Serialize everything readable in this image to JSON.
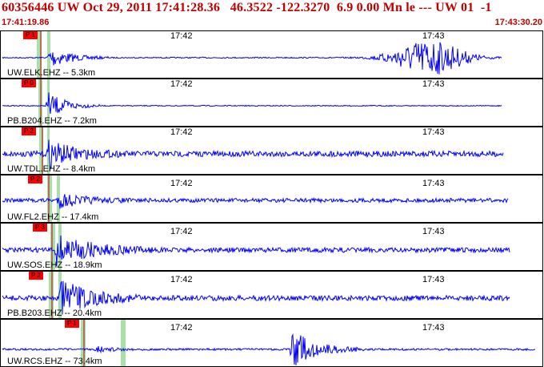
{
  "header": {
    "title": "60356446 UW Oct 29, 2011 17:41:28.36   46.3522 -122.3270  6.9 0.00 Mn le --- UW 01  -1",
    "time_start": "17:41:19.86",
    "time_end": "17:43:30.20"
  },
  "colors": {
    "header": "#c00000",
    "trace": "#0000ff",
    "pick": "#ff0000",
    "window": "#a8e0a8"
  },
  "tick_labels": [
    "17:42",
    "17:43"
  ],
  "traces": [
    {
      "label": "UW.ELK.EHZ -- 5.3km",
      "pick": "P 1"
    },
    {
      "label": "PB.B204.EHZ -- 7.2km",
      "pick": "P 0"
    },
    {
      "label": "UW.TDL.EHZ -- 8.4km",
      "pick": "P 2"
    },
    {
      "label": "UW.FL2.EHZ -- 17.4km",
      "pick": "P 2"
    },
    {
      "label": "UW.SOS.EHZ -- 18.9km",
      "pick": "P 3"
    },
    {
      "label": "PB.B203.EHZ -- 20.4km",
      "pick": "P 2"
    },
    {
      "label": "UW.RCS.EHZ -- 73.4km",
      "pick": "P 1"
    }
  ]
}
